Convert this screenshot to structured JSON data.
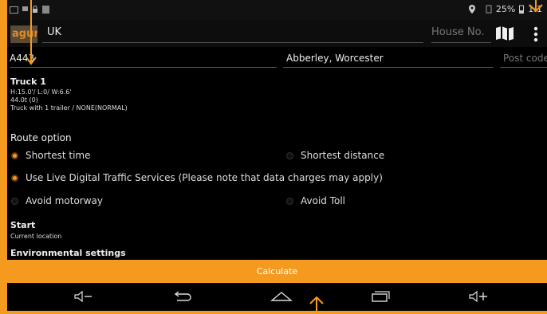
{
  "status": {
    "battery": "25%",
    "time": "1:1"
  },
  "search": {
    "logo": "aguri",
    "country": "UK",
    "house_placeholder": "House No."
  },
  "address": {
    "street": "A443",
    "town": "Abberley, Worcester",
    "postcode_placeholder": "Post code"
  },
  "vehicle": {
    "name": "Truck 1",
    "dims": "H:15.0'/ L:0/ W:6.6'",
    "weight": "44.0t (0)",
    "trailer": "Truck with 1 trailer / NONE(NORMAL)"
  },
  "route": {
    "heading": "Route option",
    "options": [
      {
        "label": "Shortest time",
        "selected": true
      },
      {
        "label": "Shortest distance",
        "selected": false
      },
      {
        "label": "Use Live Digital Traffic Services (Please note that data charges may apply)",
        "selected": true
      },
      {
        "label": "Avoid motorway",
        "selected": false
      },
      {
        "label": "Avoid Toll",
        "selected": false
      }
    ]
  },
  "start": {
    "heading": "Start",
    "value": "Current location"
  },
  "env": {
    "heading": "Environmental settings"
  },
  "calculate_label": "Calculate",
  "colors": {
    "accent": "#f39a1f",
    "background": "#000000"
  },
  "icons": [
    "menu-icon",
    "map-icon",
    "volume-down-icon",
    "back-icon",
    "home-icon",
    "recent-apps-icon",
    "volume-up-icon"
  ]
}
